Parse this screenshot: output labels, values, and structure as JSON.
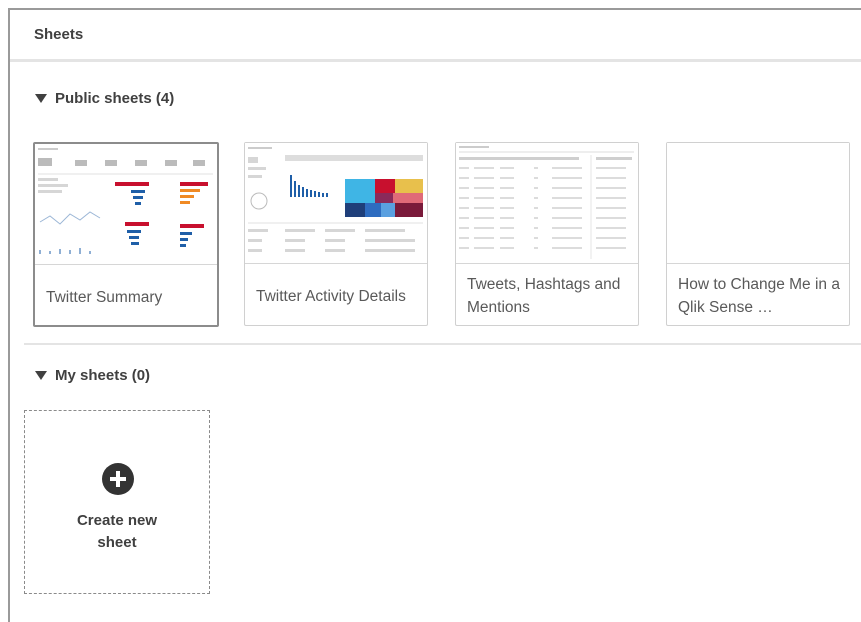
{
  "header": {
    "title": "Sheets"
  },
  "public_sheets": {
    "label": "Public sheets (4)",
    "cards": [
      {
        "title": "Twitter Summary",
        "thumbnail": "twitter-summary-thumbnail"
      },
      {
        "title": "Twitter Activity Details",
        "thumbnail": "twitter-activity-thumbnail"
      },
      {
        "title": "Tweets, Hashtags and Mentions",
        "thumbnail": "tweets-hashtags-thumbnail"
      },
      {
        "title": "How to Change Me in a Qlik Sense …",
        "thumbnail": "blank-thumbnail"
      }
    ]
  },
  "my_sheets": {
    "label": "My sheets (0)",
    "create_label": "Create new\nsheet"
  },
  "colors": {
    "accent_red": "#c8102e",
    "accent_blue": "#1f5fa8",
    "accent_orange": "#f08a24"
  }
}
